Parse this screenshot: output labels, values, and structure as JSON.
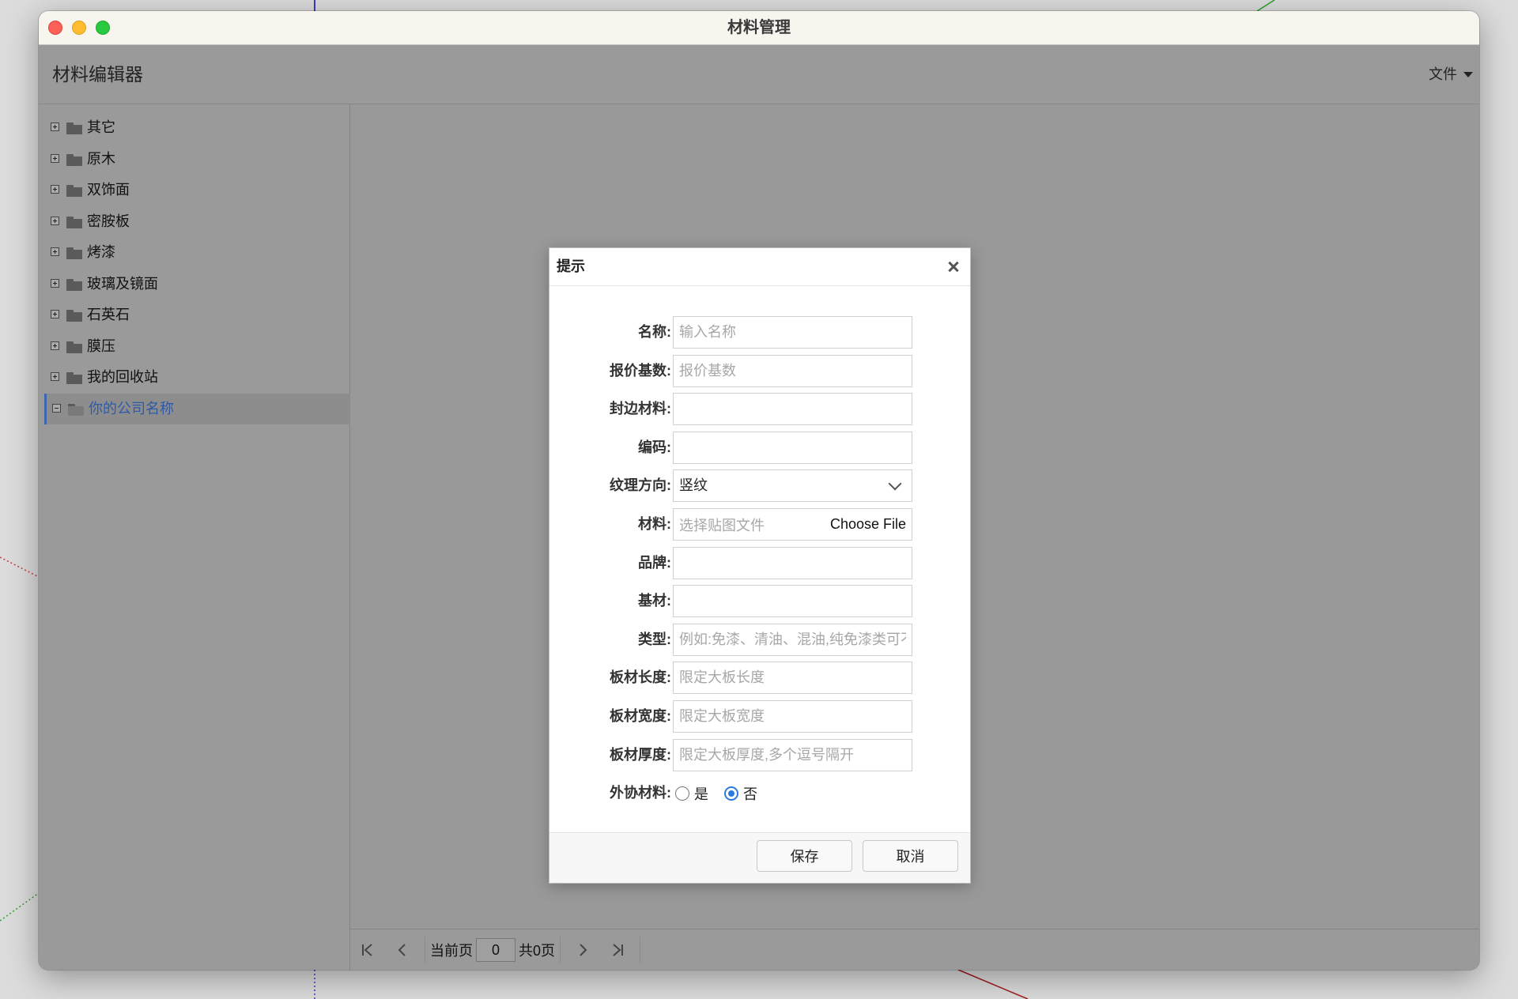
{
  "window": {
    "title": "材料管理"
  },
  "header": {
    "title": "材料编辑器",
    "file_menu": "文件"
  },
  "tree": {
    "items": [
      {
        "label": "其它",
        "expanded": false
      },
      {
        "label": "原木",
        "expanded": false
      },
      {
        "label": "双饰面",
        "expanded": false
      },
      {
        "label": "密胺板",
        "expanded": false
      },
      {
        "label": "烤漆",
        "expanded": false
      },
      {
        "label": "玻璃及镜面",
        "expanded": false
      },
      {
        "label": "石英石",
        "expanded": false
      },
      {
        "label": "膜压",
        "expanded": false
      },
      {
        "label": "我的回收站",
        "expanded": false
      },
      {
        "label": "你的公司名称",
        "expanded": true,
        "selected": true
      }
    ]
  },
  "pager": {
    "current_label": "当前页",
    "current_value": "0",
    "total_label": "共0页"
  },
  "dialog": {
    "title": "提示",
    "fields": {
      "name": {
        "label": "名称:",
        "placeholder": "输入名称",
        "value": ""
      },
      "quote_base": {
        "label": "报价基数:",
        "placeholder": "报价基数",
        "value": ""
      },
      "edge_material": {
        "label": "封边材料:",
        "placeholder": "",
        "value": ""
      },
      "code": {
        "label": "编码:",
        "placeholder": "",
        "value": ""
      },
      "grain_direction": {
        "label": "纹理方向:",
        "value": "竖纹"
      },
      "material": {
        "label": "材料:",
        "placeholder": "选择贴图文件",
        "button": "Choose File"
      },
      "brand": {
        "label": "品牌:",
        "placeholder": "",
        "value": ""
      },
      "substrate": {
        "label": "基材:",
        "placeholder": "",
        "value": ""
      },
      "type": {
        "label": "类型:",
        "placeholder": "例如:免漆、清油、混油,纯免漆类可不填",
        "value": ""
      },
      "board_length": {
        "label": "板材长度:",
        "placeholder": "限定大板长度",
        "value": ""
      },
      "board_width": {
        "label": "板材宽度:",
        "placeholder": "限定大板宽度",
        "value": ""
      },
      "board_thickness": {
        "label": "板材厚度:",
        "placeholder": "限定大板厚度,多个逗号隔开",
        "value": ""
      },
      "outsourced": {
        "label": "外协材料:",
        "yes": "是",
        "no": "否",
        "selected": "否"
      }
    },
    "save_label": "保存",
    "cancel_label": "取消"
  },
  "colors": {
    "accent": "#2a7ae2",
    "selection_border": "#3c67b5",
    "overlay_gray": "#999999"
  }
}
